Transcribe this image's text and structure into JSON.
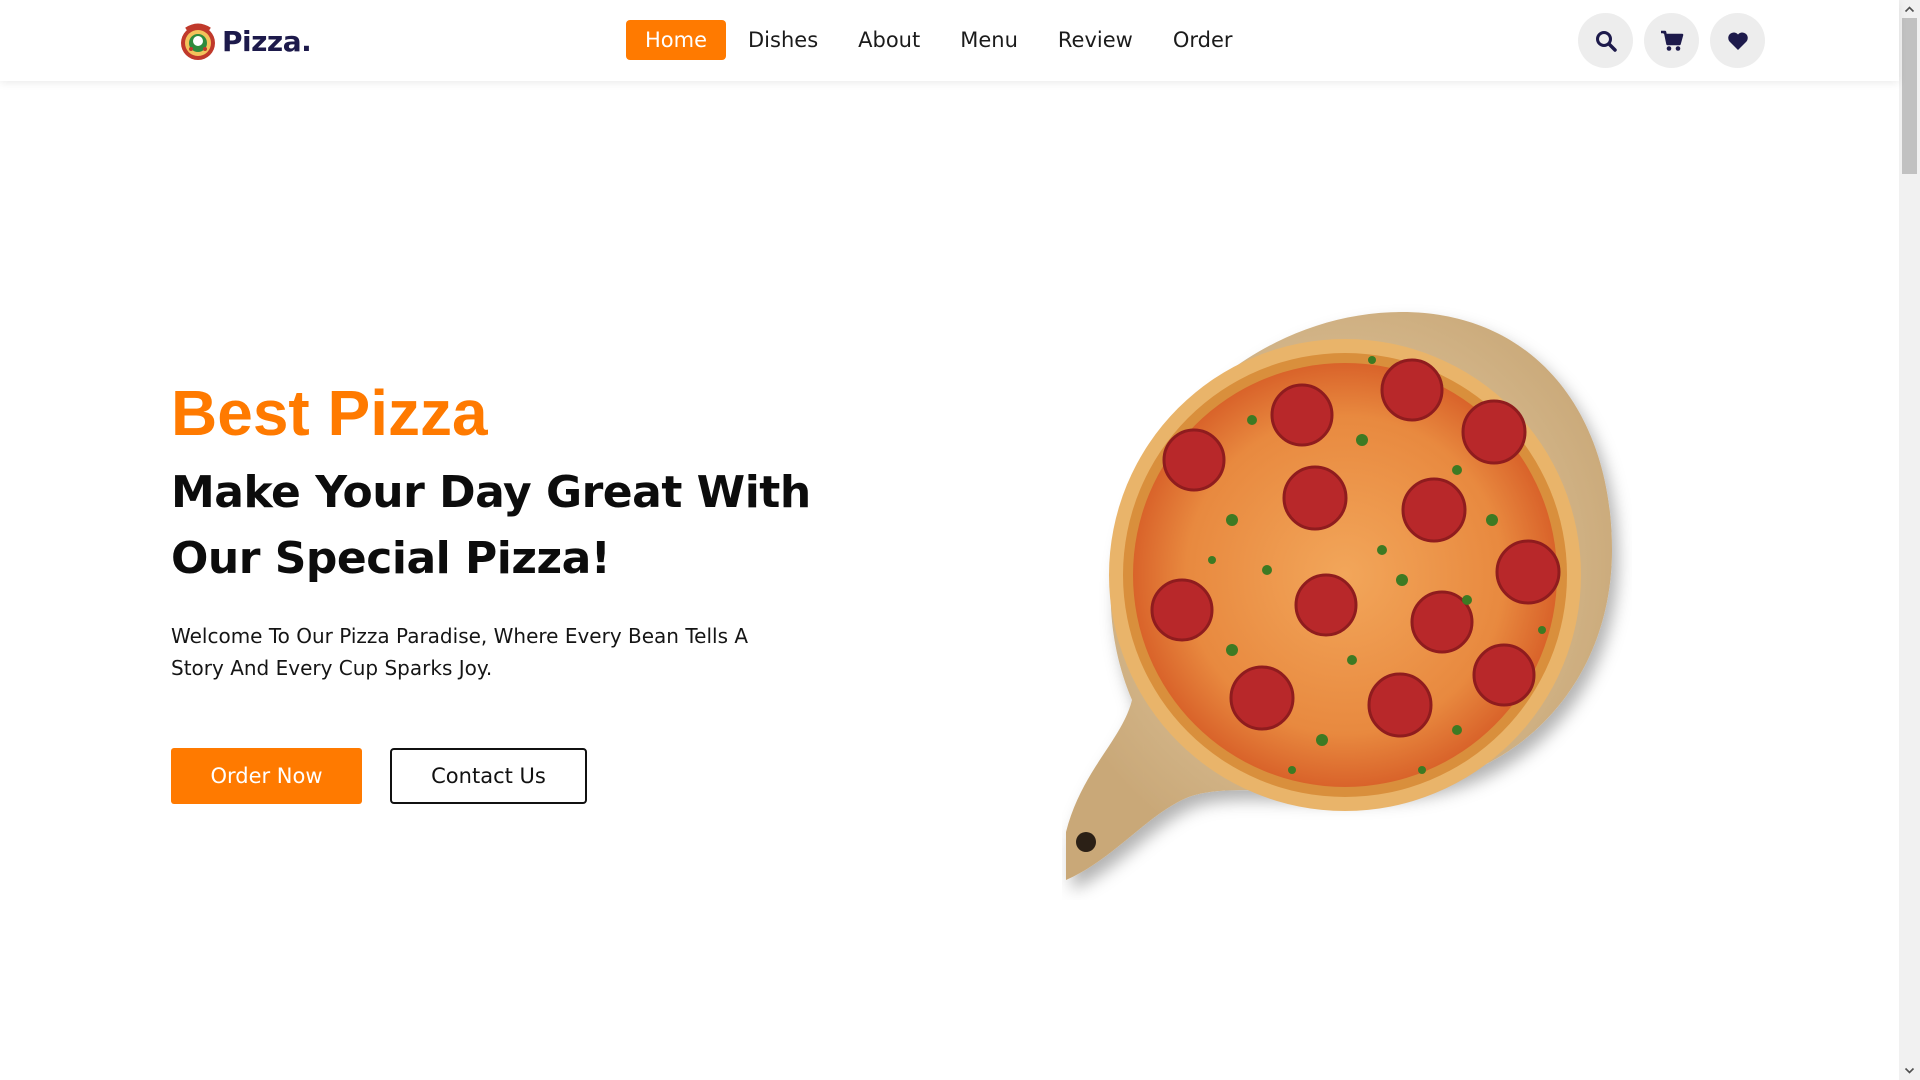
{
  "header": {
    "logo_text": "Pizza.",
    "nav": [
      {
        "label": "Home",
        "active": true
      },
      {
        "label": "Dishes",
        "active": false
      },
      {
        "label": "About",
        "active": false
      },
      {
        "label": "Menu",
        "active": false
      },
      {
        "label": "Review",
        "active": false
      },
      {
        "label": "Order",
        "active": false
      }
    ],
    "icons": [
      "search-icon",
      "cart-icon",
      "heart-icon"
    ]
  },
  "hero": {
    "subtitle": "Best Pizza",
    "title": "Make Your Day Great With Our Special Pizza!",
    "text": "Welcome To Our Pizza Paradise, Where Every Bean Tells A Story And Every Cup Sparks Joy.",
    "order_button": "Order Now",
    "contact_button": "Contact Us"
  },
  "colors": {
    "accent": "#ff7a00",
    "logo_text": "#1d1a4b",
    "icon_button_bg": "#ededed",
    "icon_color": "#1d1a4b"
  }
}
